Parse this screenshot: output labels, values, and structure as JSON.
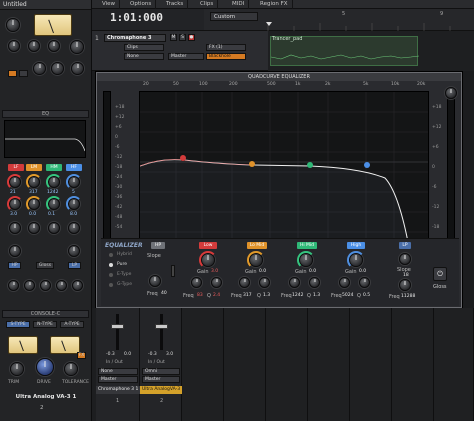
{
  "strip": {
    "title": "Untitled",
    "ch_label": "Chromaphone 3",
    "eq_header": "EQ",
    "console_header": "CONSOLE-C",
    "tube_label": "TUBE",
    "bands": [
      "LF",
      "LM",
      "HM",
      "HF"
    ],
    "btn_hp": "HP",
    "btn_gloss": "Gloss",
    "btn_lp": "LP",
    "types": [
      "S-TYPE",
      "N-TYPE",
      "A-TYPE"
    ],
    "va_labels": [
      "TRIM",
      "DRIVE",
      "TOLERANCE"
    ],
    "fx_label": "FX",
    "plugin_name": "Ultra Analog VA-3 1",
    "bottom_num": "2",
    "small_labels": [
      "Slope",
      "Freq",
      "Gain",
      "Q",
      "Freq",
      "Gain",
      "Q",
      "Freq",
      "Gain",
      "Q",
      "Freq",
      "Gain",
      "Q"
    ],
    "values_row1": [
      "21",
      "317",
      "1242",
      "5"
    ],
    "values_row2": [
      "3.0",
      "0.0",
      "0.1",
      "8.0"
    ]
  },
  "menu": {
    "items": [
      "View",
      "Options",
      "Tracks",
      "Clips",
      "MIDI",
      "Region FX"
    ]
  },
  "transport": {
    "timecode": "1:01:000",
    "mode_select": "Custom"
  },
  "track": {
    "number": "1",
    "name": "Chromaphone 3",
    "clips_btn": "Clips",
    "input": "None",
    "output": "Master",
    "fx": "FX (1)",
    "plugin": "Blackhole",
    "clip_name": "Trancer_pad",
    "ruler_marks": [
      "5",
      "9"
    ]
  },
  "eq": {
    "title": "QUADCURVE EQUALIZER",
    "freq_labels": [
      "20",
      "50",
      "100",
      "200",
      "500",
      "1k",
      "2k",
      "5k",
      "10k",
      "20k"
    ],
    "db_left": [
      "+18",
      "+12",
      "+6",
      "0",
      "-6",
      "-12",
      "-18",
      "-24",
      "-30",
      "-36",
      "-42",
      "-48",
      "-54",
      "-60"
    ],
    "db_right": [
      "+18",
      "+12",
      "+6",
      "0",
      "-6",
      "-12",
      "-18"
    ],
    "section_title": "EQUALIZER",
    "modes": [
      "Hybrid",
      "Pure",
      "E-Type",
      "G-Type"
    ],
    "bands": [
      {
        "name": "HP",
        "color": "#6f7278",
        "labels": [
          "Slope",
          "Freq"
        ],
        "values": [
          "",
          "40"
        ]
      },
      {
        "name": "Low",
        "color": "#d33b3b",
        "labels": [
          "Gain",
          "Freq",
          "Q"
        ],
        "values": [
          "3.0",
          "83",
          "2.4"
        ]
      },
      {
        "name": "Lo Mid",
        "color": "#e0922a",
        "labels": [
          "Gain",
          "Freq",
          "Q"
        ],
        "values": [
          "0.0",
          "317",
          "1.3"
        ]
      },
      {
        "name": "Hi Mid",
        "color": "#2fb877",
        "labels": [
          "Gain",
          "Freq",
          "Q"
        ],
        "values": [
          "0.0",
          "1242",
          "1.3"
        ]
      },
      {
        "name": "High",
        "color": "#4b8fe6",
        "labels": [
          "Gain",
          "Freq",
          "Q"
        ],
        "values": [
          "0.0",
          "5024",
          "0.5"
        ]
      },
      {
        "name": "LP",
        "color": "#6f7278",
        "labels": [
          "Slope",
          "Freq"
        ],
        "values": [
          "",
          "11288"
        ]
      }
    ],
    "gloss_label": "Gloss",
    "db_val": "18",
    "gain_vals": [
      "3.0",
      "0.0",
      "0.0",
      "0.0"
    ],
    "freq_vals": [
      "83",
      "317",
      "1242",
      "5024"
    ],
    "q_vals": [
      "2.4",
      "1.3",
      "1.3",
      "0.5"
    ],
    "hp_freq": "40",
    "lp_freq": "11288"
  },
  "mixer": {
    "ch1_vol": "-0.3",
    "ch1_pan": "0.0",
    "ch2_vol": "-0.3",
    "ch2_pan": "3.0",
    "io_label": "In / Out",
    "input1": "None",
    "output1": "Master",
    "input2": "Omni",
    "output2": "Master",
    "name1": "Chromaphone 3 1",
    "name2": "Ultra AnalogVA-3",
    "num1": "1",
    "num2": "2"
  }
}
